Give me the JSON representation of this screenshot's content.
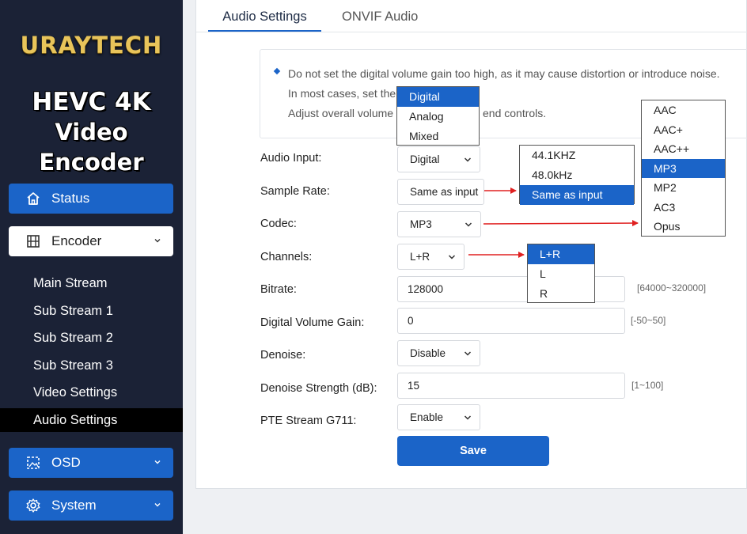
{
  "brand": {
    "logo_text": "URAYTECH",
    "product_line1": "HEVC 4K",
    "product_line2": "Video Encoder"
  },
  "sidebar": {
    "status": {
      "label": "Status",
      "icon": "home-icon"
    },
    "encoder": {
      "label": "Encoder",
      "icon": "film-icon"
    },
    "submenu": [
      "Main Stream",
      "Sub Stream 1",
      "Sub Stream 2",
      "Sub Stream 3",
      "Video Settings",
      "Audio Settings"
    ],
    "active_item": "Audio Settings",
    "osd": {
      "label": "OSD",
      "icon": "image-icon"
    },
    "system": {
      "label": "System",
      "icon": "gear-icon"
    }
  },
  "tabs": [
    {
      "label": "Audio Settings",
      "active": true
    },
    {
      "label": "ONVIF Audio",
      "active": false
    }
  ],
  "notice": {
    "line1": "Do not set the digital volume gain too high, as it may cause distortion or introduce noise.",
    "line2": "In most cases, set the",
    "line3_a": "Adjust overall volume",
    "line3_b": "end controls."
  },
  "form": {
    "audio_input": {
      "label": "Audio Input:",
      "value": "Digital"
    },
    "sample_rate": {
      "label": "Sample Rate:",
      "value": "Same as input"
    },
    "codec": {
      "label": "Codec:",
      "value": "MP3"
    },
    "channels": {
      "label": "Channels:",
      "value": "L+R"
    },
    "bitrate": {
      "label": "Bitrate:",
      "value": "128000",
      "hint": "[64000~320000]"
    },
    "digital_volume_gain": {
      "label": "Digital Volume Gain:",
      "value": "0",
      "hint": "[-50~50]"
    },
    "denoise": {
      "label": "Denoise:",
      "value": "Disable"
    },
    "denoise_strength": {
      "label": "Denoise Strength (dB):",
      "value": "15",
      "hint": "[1~100]"
    },
    "pte_stream": {
      "label": "PTE Stream G711:",
      "value": "Enable"
    },
    "save_label": "Save"
  },
  "dropdowns": {
    "audio_input": {
      "options": [
        "Digital",
        "Analog",
        "Mixed"
      ],
      "selected": "Digital"
    },
    "sample_rate": {
      "options": [
        "44.1KHZ",
        "48.0kHz",
        "Same as input"
      ],
      "selected": "Same as input"
    },
    "codec": {
      "options": [
        "AAC",
        "AAC+",
        "AAC++",
        "MP3",
        "MP2",
        "AC3",
        "Opus"
      ],
      "selected": "MP3"
    },
    "channels": {
      "options": [
        "L+R",
        "L",
        "R"
      ],
      "selected": "L+R"
    }
  },
  "colors": {
    "sidebar_bg": "#1b2236",
    "accent": "#1b64c8",
    "annotation_arrow": "#e02020"
  }
}
